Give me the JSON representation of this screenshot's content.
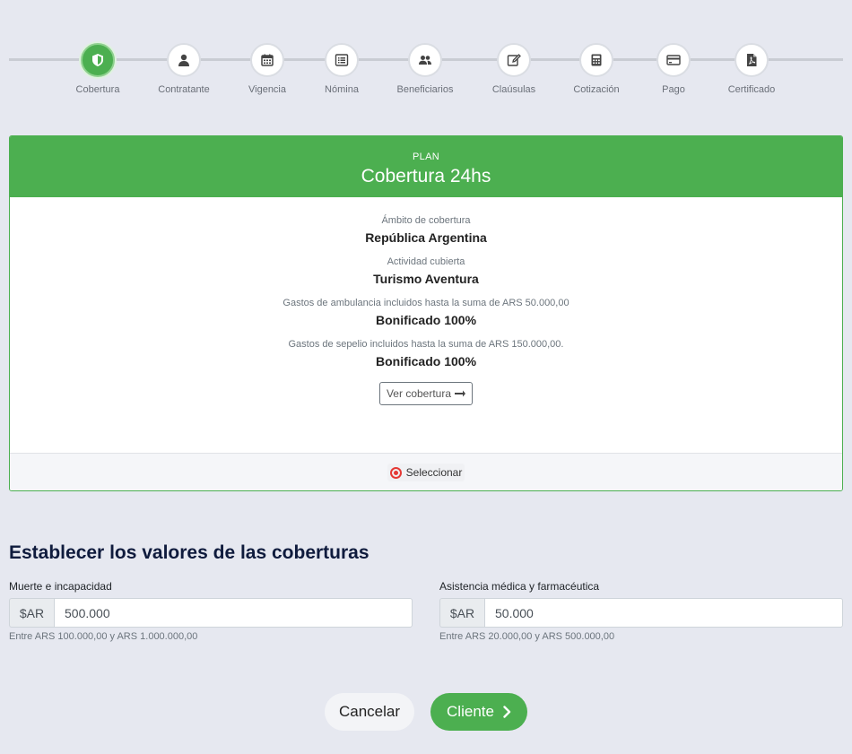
{
  "stepper": {
    "steps": [
      {
        "label": "Cobertura",
        "icon": "shield-icon"
      },
      {
        "label": "Contratante",
        "icon": "user-icon"
      },
      {
        "label": "Vigencia",
        "icon": "calendar-icon"
      },
      {
        "label": "Nómina",
        "icon": "list-icon"
      },
      {
        "label": "Beneficiarios",
        "icon": "users-icon"
      },
      {
        "label": "Claúsulas",
        "icon": "edit-icon"
      },
      {
        "label": "Cotización",
        "icon": "calculator-icon"
      },
      {
        "label": "Pago",
        "icon": "credit-card-icon"
      },
      {
        "label": "Certificado",
        "icon": "pdf-file-icon"
      }
    ],
    "active": "Cobertura"
  },
  "plan": {
    "kicker": "PLAN",
    "title": "Cobertura 24hs",
    "features": [
      {
        "label": "Ámbito de cobertura",
        "value": "República Argentina"
      },
      {
        "label": "Actividad cubierta",
        "value": "Turismo Aventura"
      },
      {
        "label": "Gastos de ambulancia incluidos hasta la suma de ARS 50.000,00",
        "value": "Bonificado 100%"
      },
      {
        "label": "Gastos de sepelio incluidos hasta la suma de ARS 150.000,00.",
        "value": "Bonificado 100%"
      }
    ],
    "view_button": "Ver cobertura",
    "select_label": "Seleccionar"
  },
  "coverage_values": {
    "title": "Establecer los valores de las coberturas",
    "fields": [
      {
        "label": "Muerte e incapacidad",
        "prefix": "$AR",
        "value": "500.000",
        "hint": "Entre ARS 100.000,00 y ARS 1.000.000,00"
      },
      {
        "label": "Asistencia médica y farmacéutica",
        "prefix": "$AR",
        "value": "50.000",
        "hint": "Entre ARS 20.000,00 y ARS 500.000,00"
      }
    ]
  },
  "actions": {
    "cancel": "Cancelar",
    "next": "Cliente"
  },
  "colors": {
    "accent": "#4caf50",
    "background": "#e6e8f0",
    "radio": "#e53935"
  }
}
